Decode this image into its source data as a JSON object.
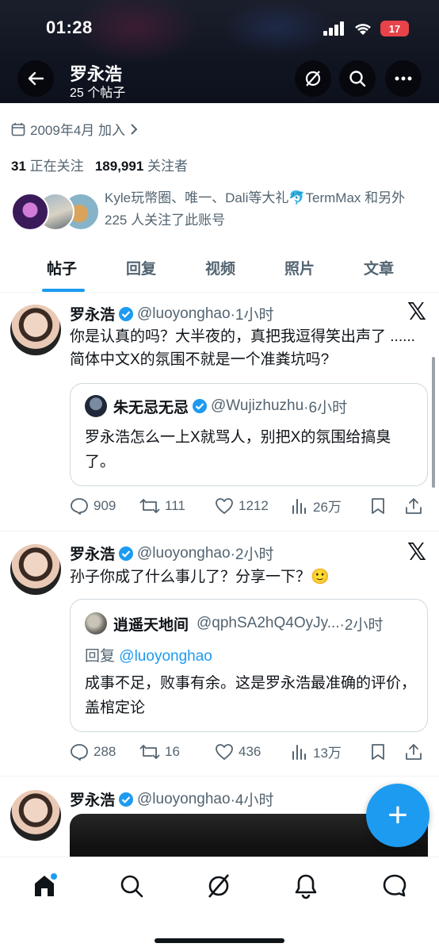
{
  "status_bar": {
    "time": "01:28",
    "battery": "17"
  },
  "header": {
    "name": "罗永浩",
    "subtitle": "25 个帖子"
  },
  "profile": {
    "joined": "2009年4月 加入",
    "following_count": "31",
    "following_label": "正在关注",
    "followers_count": "189,991",
    "followers_label": "关注者",
    "followed_by": "Kyle玩幣圈、唯一、Dali等大礼🐬TermMax 和另外 225 人关注了此账号"
  },
  "tabs": [
    "帖子",
    "回复",
    "视频",
    "照片",
    "文章"
  ],
  "posts": [
    {
      "name": "罗永浩",
      "handle": "@luoyonghao",
      "time": "·1小时",
      "text": "你是认真的吗？大半夜的，真把我逗得笑出声了 ...... 简体中文X的氛围不就是一个准粪坑吗?",
      "quote": {
        "name": "朱无忌无忌",
        "handle": "@Wujizhuzhu",
        "time": "·6小时",
        "text": "罗永浩怎么一上X就骂人，别把X的氛围给搞臭了。"
      },
      "replies": "909",
      "reposts": "111",
      "likes": "1212",
      "views": "26万"
    },
    {
      "name": "罗永浩",
      "handle": "@luoyonghao",
      "time": "·2小时",
      "text": "孙子你成了什么事儿了？分享一下？🙂",
      "quote": {
        "name": "逍遥天地间",
        "handle": "@qphSA2hQ4OyJy...",
        "time": "·2小时",
        "reply_prefix": "回复",
        "reply_to": "@luoyonghao",
        "text": "成事不足，败事有余。这是罗永浩最准确的评价，盖棺定论"
      },
      "replies": "288",
      "reposts": "16",
      "likes": "436",
      "views": "13万"
    },
    {
      "name": "罗永浩",
      "handle": "@luoyonghao",
      "time": "·4小时"
    }
  ],
  "fab": {
    "label": "+"
  },
  "colors": {
    "accent": "#1d9bf0",
    "text": "#0f1419",
    "muted": "#536471"
  }
}
